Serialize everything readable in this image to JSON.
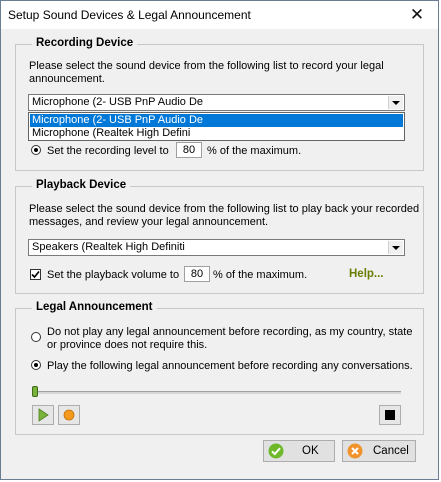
{
  "window": {
    "title": "Setup Sound Devices & Legal Announcement"
  },
  "recording": {
    "legend": "Recording Device",
    "instructions_line1": "Please select the sound device from the following list to record your legal",
    "instructions_line2": "announcement.",
    "selected_device": "Microphone (2- USB PnP Audio De",
    "options": [
      "Microphone (2- USB PnP Audio De",
      "Microphone (Realtek High Defini"
    ],
    "level_label_prefix": "Set the recording level to",
    "level_value": "80",
    "level_label_suffix": "% of the maximum."
  },
  "playback": {
    "legend": "Playback Device",
    "instructions_line1": "Please select the sound device from the following list to play back your recorded",
    "instructions_line2": "messages, and review your legal announcement.",
    "selected_device": "Speakers (Realtek High Definiti",
    "volume_label_prefix": "Set the playback volume to",
    "volume_value": "80",
    "volume_label_suffix": "% of the maximum.",
    "help_label": "Help..."
  },
  "legal": {
    "legend": "Legal Announcement",
    "option1_line1": "Do not play any legal announcement before recording, as my country, state",
    "option1_line2": "or province does not require this.",
    "option2": "Play the following legal announcement before recording any conversations.",
    "slider_position": 0
  },
  "buttons": {
    "ok": "OK",
    "cancel": "Cancel"
  },
  "colors": {
    "selection": "#0078d7",
    "help": "#6b7d00",
    "play": "#7ab33c",
    "record": "#f39a1e",
    "ok_icon": "#6fb82a",
    "cancel_icon": "#f0932b"
  }
}
